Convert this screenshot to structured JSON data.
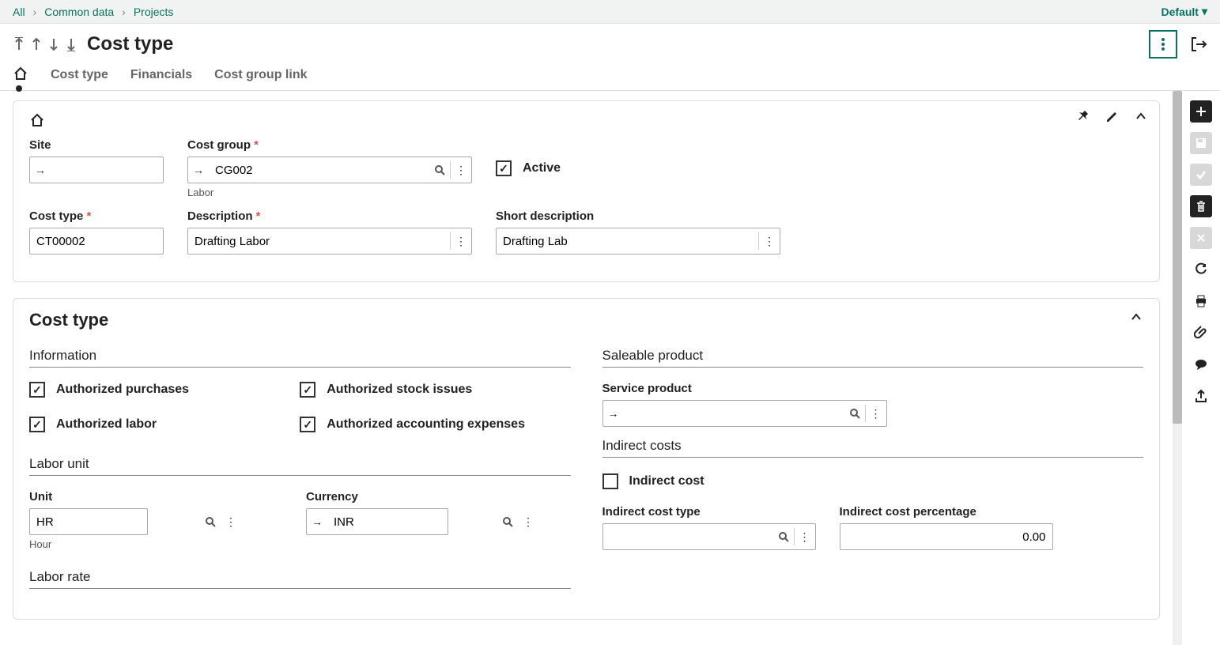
{
  "breadcrumb": {
    "items": [
      "All",
      "Common data",
      "Projects"
    ],
    "default_label": "Default"
  },
  "header": {
    "title": "Cost type",
    "tabs": [
      "Cost type",
      "Financials",
      "Cost group link"
    ]
  },
  "panel1": {
    "site_label": "Site",
    "site_value": "",
    "cost_group_label": "Cost group",
    "cost_group_value": "CG002",
    "cost_group_helper": "Labor",
    "active_label": "Active",
    "cost_type_label": "Cost type",
    "cost_type_value": "CT00002",
    "description_label": "Description",
    "description_value": "Drafting Labor",
    "short_desc_label": "Short description",
    "short_desc_value": "Drafting Lab"
  },
  "panel2": {
    "section_title": "Cost type",
    "information_title": "Information",
    "auth_purchases_label": "Authorized purchases",
    "auth_stock_label": "Authorized stock issues",
    "auth_labor_label": "Authorized labor",
    "auth_acct_label": "Authorized accounting expenses",
    "labor_unit_title": "Labor unit",
    "unit_label": "Unit",
    "unit_value": "HR",
    "unit_helper": "Hour",
    "currency_label": "Currency",
    "currency_value": "INR",
    "labor_rate_title": "Labor rate",
    "saleable_title": "Saleable product",
    "service_product_label": "Service product",
    "service_product_value": "",
    "indirect_costs_title": "Indirect costs",
    "indirect_cost_label": "Indirect cost",
    "indirect_cost_type_label": "Indirect cost type",
    "indirect_cost_type_value": "",
    "indirect_pct_label": "Indirect cost percentage",
    "indirect_pct_value": "0.00"
  }
}
